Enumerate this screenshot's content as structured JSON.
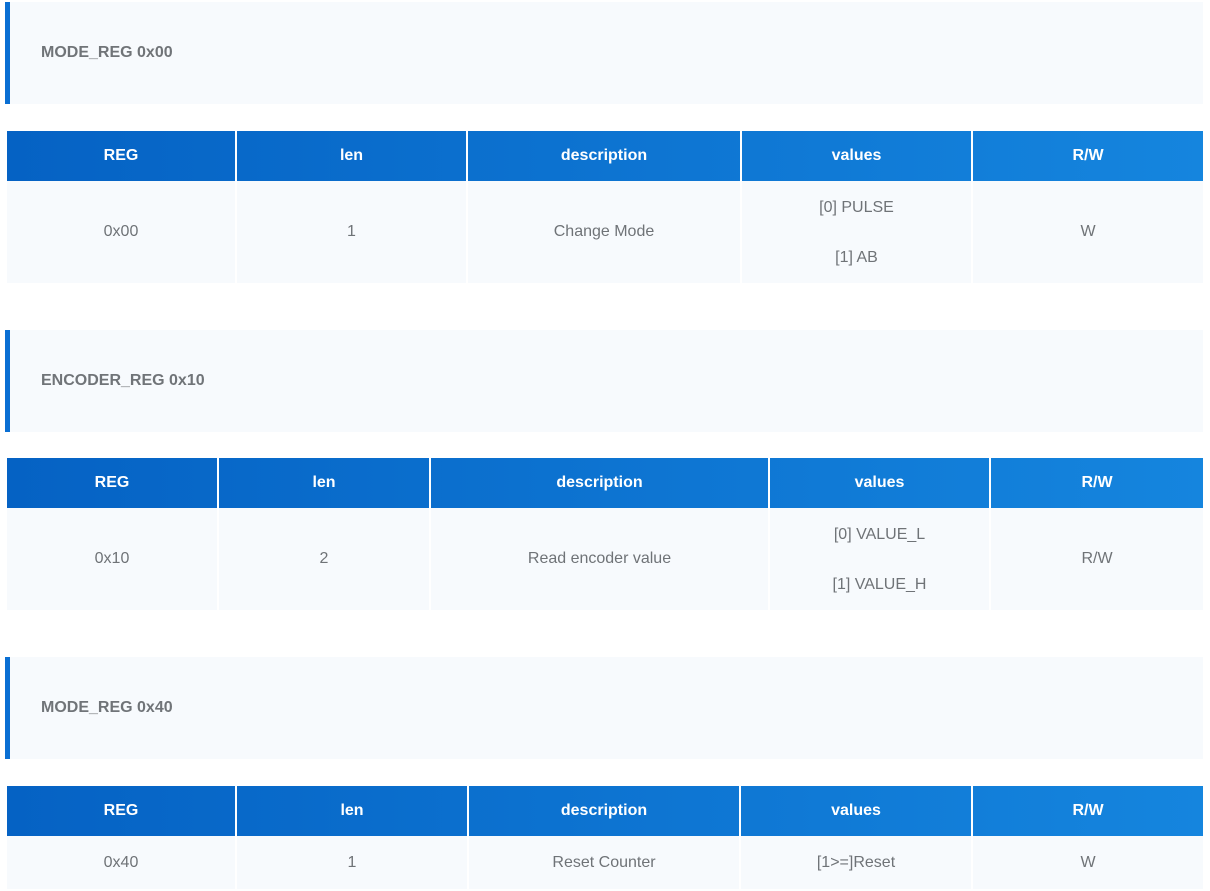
{
  "sections": [
    {
      "title": "MODE_REG 0x00",
      "headers": [
        "REG",
        "len",
        "description",
        "values",
        "R/W"
      ],
      "row": {
        "reg": "0x00",
        "len": "1",
        "description": "Change Mode",
        "values": [
          "[0] PULSE",
          "[1] AB"
        ],
        "rw": "W"
      }
    },
    {
      "title": "ENCODER_REG 0x10",
      "headers": [
        "REG",
        "len",
        "description",
        "values",
        "R/W"
      ],
      "row": {
        "reg": "0x10",
        "len": "2",
        "description": "Read encoder value",
        "values": [
          "[0] VALUE_L",
          "[1] VALUE_H"
        ],
        "rw": "R/W"
      }
    },
    {
      "title": "MODE_REG 0x40",
      "headers": [
        "REG",
        "len",
        "description",
        "values",
        "R/W"
      ],
      "row": {
        "reg": "0x40",
        "len": "1",
        "description": "Reset Counter",
        "values": [
          "[1>=]Reset"
        ],
        "rw": "W"
      }
    }
  ],
  "colors": {
    "accent": "#0a6fd3",
    "header_start": "#0562c4",
    "header_end": "#1585de",
    "panel_bg": "#f7fafd",
    "text": "#6f7377"
  }
}
